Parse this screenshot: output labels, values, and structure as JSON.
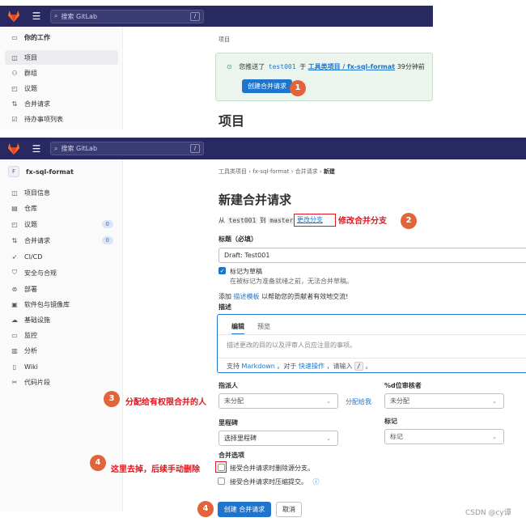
{
  "top_screenshot": {
    "search_placeholder": "搜索 GitLab",
    "search_kbd": "/",
    "sidebar_title": "你的工作",
    "sidebar_items": [
      {
        "label": "项目",
        "icon": "project-icon"
      },
      {
        "label": "群组",
        "icon": "group-icon"
      },
      {
        "label": "议题",
        "icon": "issue-icon"
      },
      {
        "label": "合并请求",
        "icon": "merge-request-icon"
      },
      {
        "label": "待办事项列表",
        "icon": "todo-icon"
      }
    ],
    "breadcrumb": "项目",
    "notice": {
      "prefix": "您推送了",
      "branch": "test001",
      "middle": "于",
      "project_link": "工具类项目 / fx-sql-format",
      "time": "39分钟前"
    },
    "create_mr_button": "创建合并请求",
    "page_title": "项目"
  },
  "bottom_screenshot": {
    "search_placeholder": "搜索 GitLab",
    "search_kbd": "/",
    "project_avatar": "F",
    "project_name": "fx-sql-format",
    "sidebar_items": [
      {
        "label": "项目信息",
        "icon": "info-icon"
      },
      {
        "label": "仓库",
        "icon": "repository-icon"
      },
      {
        "label": "议题",
        "icon": "issue-icon",
        "count": "0"
      },
      {
        "label": "合并请求",
        "icon": "merge-request-icon",
        "count": "0"
      },
      {
        "label": "CI/CD",
        "icon": "rocket-icon"
      },
      {
        "label": "安全与合规",
        "icon": "shield-icon"
      },
      {
        "label": "部署",
        "icon": "deploy-icon"
      },
      {
        "label": "软件包与镜像库",
        "icon": "package-icon"
      },
      {
        "label": "基础设施",
        "icon": "cloud-icon"
      },
      {
        "label": "监控",
        "icon": "monitor-icon"
      },
      {
        "label": "分析",
        "icon": "chart-icon"
      },
      {
        "label": "Wiki",
        "icon": "book-icon"
      },
      {
        "label": "代码片段",
        "icon": "snippet-icon"
      }
    ],
    "breadcrumbs": [
      "工具类项目",
      "fx-sql-format",
      "合并请求",
      "新建"
    ],
    "page_title": "新建合并请求",
    "from_text": "从",
    "source_branch": "test001",
    "to_text": "到",
    "target_branch": "master",
    "change_branch": "更改分支",
    "title_label": "标题（必填）",
    "title_value": "Draft: Test001",
    "draft_label": "标记为草稿",
    "draft_hint": "在被标记为准备就绪之前，无法合并草稿。",
    "template_prefix": "添加",
    "template_link": "描述模板",
    "template_suffix": "以帮助您的贡献者有效地交流!",
    "description_label": "描述",
    "tab_edit": "编辑",
    "tab_preview": "预览",
    "description_placeholder": "描述更改的目的以及评审人员应注意的事项。",
    "md_prefix": "支持",
    "md_link": "Markdown",
    "md_mid": "。对于",
    "md_link2": "快速操作",
    "md_suffix": "，请输入",
    "md_kbd": "/",
    "md_end": "。",
    "assignee_label": "指派人",
    "assignee_value": "未分配",
    "assign_to_me": "分配给我",
    "reviewer_label": "%d位审核者",
    "reviewer_value": "未分配",
    "milestone_label": "里程碑",
    "milestone_value": "选择里程碑",
    "labels_label": "标记",
    "labels_value": "标记",
    "merge_options_label": "合并选项",
    "option_delete_branch": "接受合并请求时删除源分支。",
    "option_squash": "接受合并请求时压缩提交。",
    "submit_button": "创建 合并请求",
    "cancel_button": "取消"
  },
  "annotations": {
    "step1": "1",
    "step2": "2",
    "step2_text": "修改合并分支",
    "step3": "3",
    "step3_text": "分配给有权限合并的人",
    "step4a": "4",
    "step4a_text": "这里去掉，后续手动删除",
    "step4b": "4"
  },
  "watermark": "CSDN @cy谭",
  "colors": {
    "topbar": "#292961",
    "primary": "#1f75cb",
    "annotation_red": "#e3141d",
    "step_circle": "#e2643a",
    "notice_bg": "#ecf4ee"
  }
}
